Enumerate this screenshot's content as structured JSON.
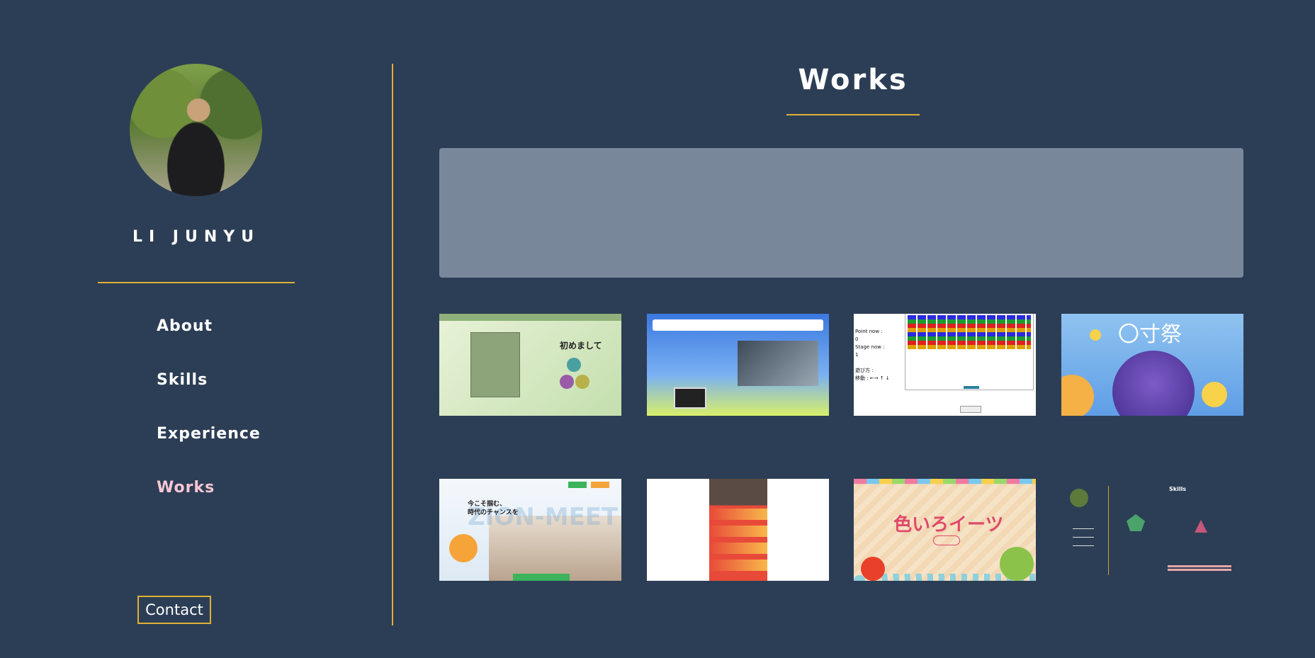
{
  "profile": {
    "name": "LI JUNYU"
  },
  "nav": {
    "items": [
      {
        "label": "About"
      },
      {
        "label": "Skills"
      },
      {
        "label": "Experience"
      },
      {
        "label": "Works"
      }
    ],
    "active": "Works",
    "contact_label": "Contact"
  },
  "main": {
    "title": "Works"
  },
  "works": {
    "thumbs": [
      {
        "caption": "初めまして"
      },
      {
        "caption": ""
      },
      {
        "caption": "Point now :\n0\nStage now :\n1\n\n遊び方 :\n移動 : ←→ ↑ ↓"
      },
      {
        "caption": "〇寸祭"
      },
      {
        "caption": "今こそ掴む、\n時代のチャンスを",
        "watermark": "ZION-MEET"
      },
      {
        "caption": ""
      },
      {
        "caption": "色いろイーツ"
      },
      {
        "caption": "Skills"
      }
    ]
  },
  "colors": {
    "background": "#2c3e55",
    "accent": "#e0b035",
    "active_nav": "#f8c6d4",
    "banner": "#78889a"
  }
}
